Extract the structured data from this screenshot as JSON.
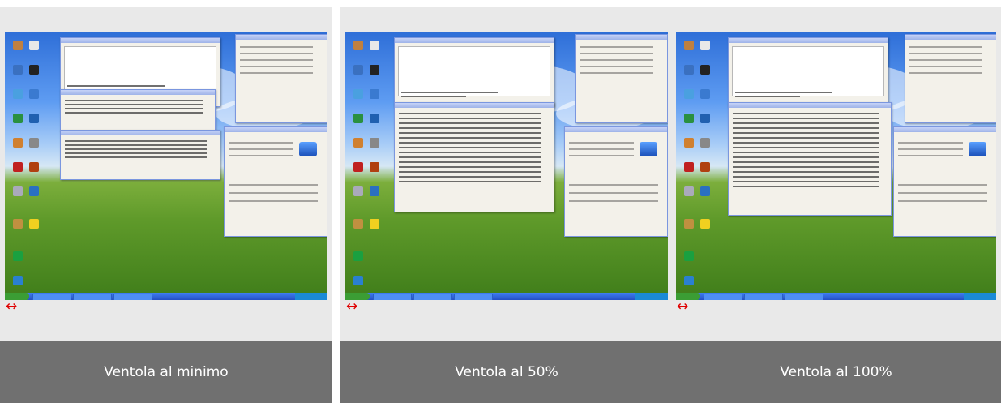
{
  "gallery": {
    "items": [
      {
        "caption": "Ventola al minimo"
      },
      {
        "caption": "Ventola al 50%"
      },
      {
        "caption": "Ventola al 100%"
      }
    ]
  },
  "icons": {
    "expand": "↔"
  },
  "colors": {
    "caption_bg": "#707070",
    "arrow": "#e00000"
  }
}
